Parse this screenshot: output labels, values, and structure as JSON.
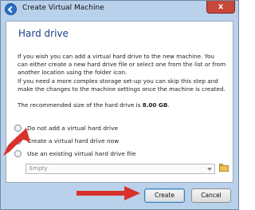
{
  "window": {
    "title": "Create Virtual Machine",
    "close_glyph": "x"
  },
  "page": {
    "heading": "Hard drive",
    "paragraph1": "If you wish you can add a virtual hard drive to the new machine. You can either create a new hard drive file or select one from the list or from another location using the folder icon.",
    "paragraph2": "If you need a more complex storage set-up you can skip this step and make the changes to the machine settings once the machine is created.",
    "recommended_prefix": "The recommended size of the hard drive is ",
    "recommended_size": "8.00 GB",
    "recommended_suffix": "."
  },
  "options": [
    {
      "label": "Do not add a virtual hard drive",
      "selected": false
    },
    {
      "label": "Create a virtual hard drive now",
      "selected": true
    },
    {
      "label": "Use an existing virtual hard drive file",
      "selected": false
    }
  ],
  "existing_file_select": {
    "value": "Empty"
  },
  "buttons": {
    "create": "Create",
    "cancel": "Cancel"
  },
  "colors": {
    "annotation_arrow": "#d9322b",
    "accent": "#1a3e8a"
  }
}
